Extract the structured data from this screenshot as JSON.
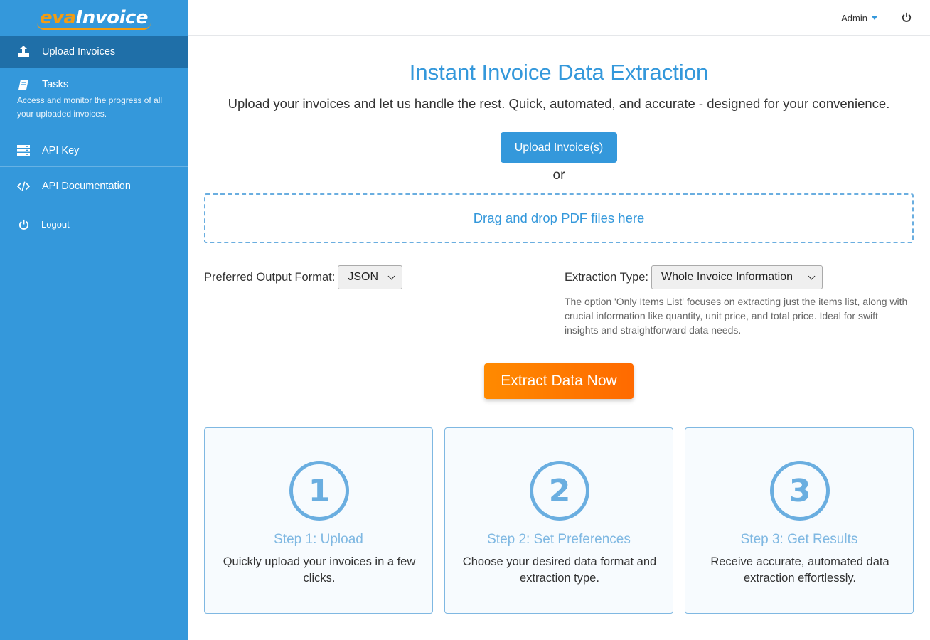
{
  "brand": {
    "logo_part1": "eva",
    "logo_part2": "Invoice"
  },
  "sidebar": {
    "items": [
      {
        "label": "Upload Invoices",
        "icon": "upload-icon"
      },
      {
        "label": "Tasks",
        "icon": "book-icon",
        "description": "Access and monitor the progress of all your uploaded invoices."
      },
      {
        "label": "API Key",
        "icon": "server-icon"
      },
      {
        "label": "API Documentation",
        "icon": "code-icon"
      }
    ],
    "logout_label": "Logout"
  },
  "topbar": {
    "user_label": "Admin"
  },
  "main": {
    "title": "Instant Invoice Data Extraction",
    "subtitle": "Upload your invoices and let us handle the rest. Quick, automated, and accurate - designed for your convenience.",
    "upload_button": "Upload Invoice(s)",
    "or_text": "or",
    "dropzone_text": "Drag and drop PDF files here",
    "format_label": "Preferred Output Format:",
    "format_value": "JSON",
    "type_label": "Extraction Type:",
    "type_value": "Whole Invoice Information",
    "type_help": "The option 'Only Items List' focuses on extracting just the items list, along with crucial information like quantity, unit price, and total price. Ideal for swift insights and straightforward data needs.",
    "extract_button": "Extract Data Now"
  },
  "steps": [
    {
      "number": "1",
      "title": "Step 1: Upload",
      "desc": "Quickly upload your invoices in a few clicks."
    },
    {
      "number": "2",
      "title": "Step 2: Set Preferences",
      "desc": "Choose your desired data format and extraction type."
    },
    {
      "number": "3",
      "title": "Step 3: Get Results",
      "desc": "Receive accurate, automated data extraction effortlessly."
    }
  ],
  "colors": {
    "primary": "#3498db",
    "sidebar_active": "#1f6fa8",
    "accent_orange": "#ff7a00",
    "logo_orange": "#f39c12"
  }
}
